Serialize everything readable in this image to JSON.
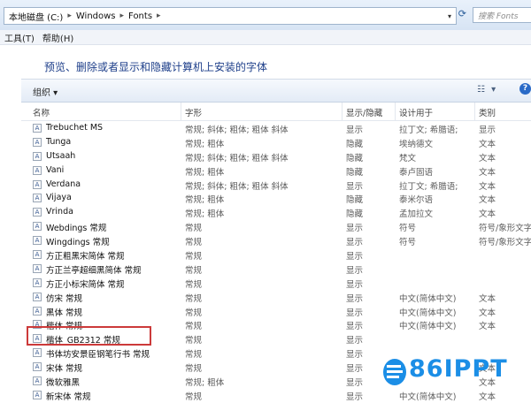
{
  "address": {
    "crumbs": [
      "本地磁盘 (C:)",
      "Windows",
      "Fonts"
    ],
    "search_placeholder": "搜索 Fonts"
  },
  "menu": {
    "tools": "工具(T)",
    "help": "帮助(H)"
  },
  "banner": {
    "title": "预览、删除或者显示和隐藏计算机上安装的字体"
  },
  "toolbar": {
    "organize": "组织 ▾"
  },
  "columns": {
    "name": "名称",
    "style": "字形",
    "show": "显示/隐藏",
    "purpose": "设计用于",
    "category": "类别"
  },
  "rows": [
    {
      "name": "Trebuchet MS",
      "style": "常规; 斜体; 粗体; 粗体 斜体",
      "show": "显示",
      "purpose": "拉丁文; 希腊语;",
      "category": "显示"
    },
    {
      "name": "Tunga",
      "style": "常规; 粗体",
      "show": "隐藏",
      "purpose": "埃纳德文",
      "category": "文本"
    },
    {
      "name": "Utsaah",
      "style": "常规; 斜体; 粗体; 粗体 斜体",
      "show": "隐藏",
      "purpose": "梵文",
      "category": "文本"
    },
    {
      "name": "Vani",
      "style": "常规; 粗体",
      "show": "隐藏",
      "purpose": "泰卢固语",
      "category": "文本"
    },
    {
      "name": "Verdana",
      "style": "常规; 斜体; 粗体; 粗体 斜体",
      "show": "显示",
      "purpose": "拉丁文; 希腊语;",
      "category": "文本"
    },
    {
      "name": "Vijaya",
      "style": "常规; 粗体",
      "show": "隐藏",
      "purpose": "泰米尔语",
      "category": "文本"
    },
    {
      "name": "Vrinda",
      "style": "常规; 粗体",
      "show": "隐藏",
      "purpose": "孟加拉文",
      "category": "文本"
    },
    {
      "name": "Webdings 常规",
      "style": "常规",
      "show": "显示",
      "purpose": "符号",
      "category": "符号/象形文字"
    },
    {
      "name": "Wingdings 常规",
      "style": "常规",
      "show": "显示",
      "purpose": "符号",
      "category": "符号/象形文字"
    },
    {
      "name": "方正粗黑宋简体 常规",
      "style": "常规",
      "show": "显示",
      "purpose": "",
      "category": ""
    },
    {
      "name": "方正兰亭超细黑简体 常规",
      "style": "常规",
      "show": "显示",
      "purpose": "",
      "category": ""
    },
    {
      "name": "方正小标宋简体 常规",
      "style": "常规",
      "show": "显示",
      "purpose": "",
      "category": ""
    },
    {
      "name": "仿宋 常规",
      "style": "常规",
      "show": "显示",
      "purpose": "中文(简体中文)",
      "category": "文本"
    },
    {
      "name": "黑体 常规",
      "style": "常规",
      "show": "显示",
      "purpose": "中文(简体中文)",
      "category": "文本"
    },
    {
      "name": "楷体 常规",
      "style": "常规",
      "show": "显示",
      "purpose": "中文(简体中文)",
      "category": "文本"
    },
    {
      "name": "楷体_GB2312 常规",
      "style": "常规",
      "show": "显示",
      "purpose": "",
      "category": ""
    },
    {
      "name": "书体坊安景臣钢笔行书 常规",
      "style": "常规",
      "show": "显示",
      "purpose": "",
      "category": ""
    },
    {
      "name": "宋体 常规",
      "style": "常规",
      "show": "显示",
      "purpose": "",
      "category": "文本"
    },
    {
      "name": "微软雅黑",
      "style": "常规; 粗体",
      "show": "显示",
      "purpose": "",
      "category": "文本"
    },
    {
      "name": "新宋体 常规",
      "style": "常规",
      "show": "显示",
      "purpose": "中文(简体中文)",
      "category": "文本"
    }
  ],
  "watermark": "86IPPT"
}
